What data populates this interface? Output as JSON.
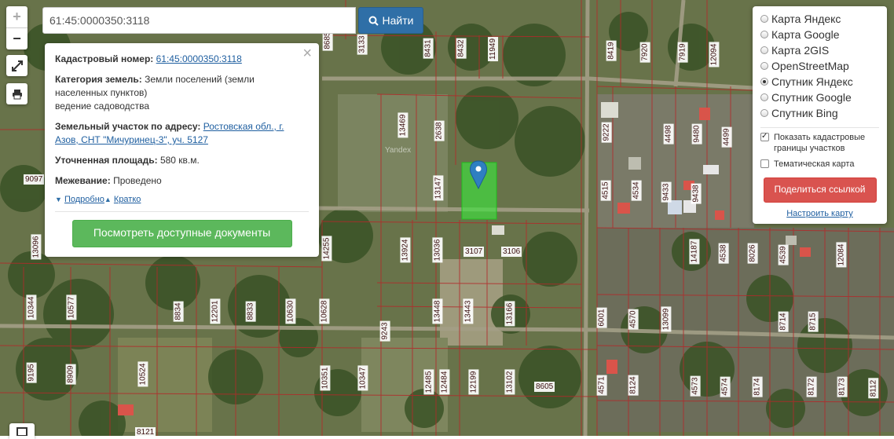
{
  "search": {
    "value": "61:45:0000350:3118",
    "button_label": "Найти"
  },
  "zoom": {
    "in": "+",
    "out": "−"
  },
  "popup": {
    "cadastral_label": "Кадастровый номер:",
    "cadastral_value": "61:45:0000350:3118",
    "category_label": "Категория земель:",
    "category_value": "Земли поселений (земли населенных пунктов)",
    "usage_value": "ведение садоводства",
    "address_label": "Земельный участок по адресу:",
    "address_value": "Ростовская обл., г. Азов, СНТ \"Мичуринец-3\", уч. 5127",
    "area_label": "Уточненная площадь:",
    "area_value": "580 кв.м.",
    "survey_label": "Межевание:",
    "survey_value": "Проведено",
    "more_link": "Подробно",
    "less_link": "Кратко",
    "docs_button": "Посмотреть доступные документы"
  },
  "layers": {
    "items": [
      {
        "label": "Карта Яндекс",
        "selected": false
      },
      {
        "label": "Карта Google",
        "selected": false
      },
      {
        "label": "Карта 2GIS",
        "selected": false
      },
      {
        "label": "OpenStreetMap",
        "selected": false
      },
      {
        "label": "Спутник Яндекс",
        "selected": true
      },
      {
        "label": "Спутник Google",
        "selected": false
      },
      {
        "label": "Спутник Bing",
        "selected": false
      }
    ],
    "show_borders_label": "Показать кадастровые границы участков",
    "show_borders_checked": true,
    "thematic_label": "Тематическая карта",
    "thematic_checked": false,
    "share_button": "Поделиться ссылкой",
    "configure_link": "Настроить карту"
  },
  "map": {
    "watermark": "Yandex",
    "parcel_labels": [
      "10351",
      "8685",
      "3133",
      "8431",
      "8432",
      "11949",
      "8419",
      "7920",
      "7919",
      "12094",
      "13469",
      "2638",
      "9222",
      "4498",
      "9480",
      "4499",
      "13147",
      "4515",
      "4534",
      "9433",
      "9438",
      "9097",
      "13096",
      "13924",
      "13036",
      "3107",
      "3106",
      "14255",
      "14187",
      "4538",
      "8026",
      "4539",
      "12084",
      "10344",
      "10577",
      "8834",
      "12201",
      "8833",
      "10630",
      "10628",
      "9243",
      "13448",
      "13443",
      "13166",
      "6001",
      "4570",
      "13099",
      "8714",
      "8715",
      "9195",
      "8909",
      "10524",
      "10351",
      "10347",
      "12485",
      "12484",
      "12199",
      "13102",
      "8605",
      "4571",
      "8124",
      "4573",
      "4574",
      "8174",
      "8172",
      "8173",
      "8112",
      "8121"
    ]
  }
}
